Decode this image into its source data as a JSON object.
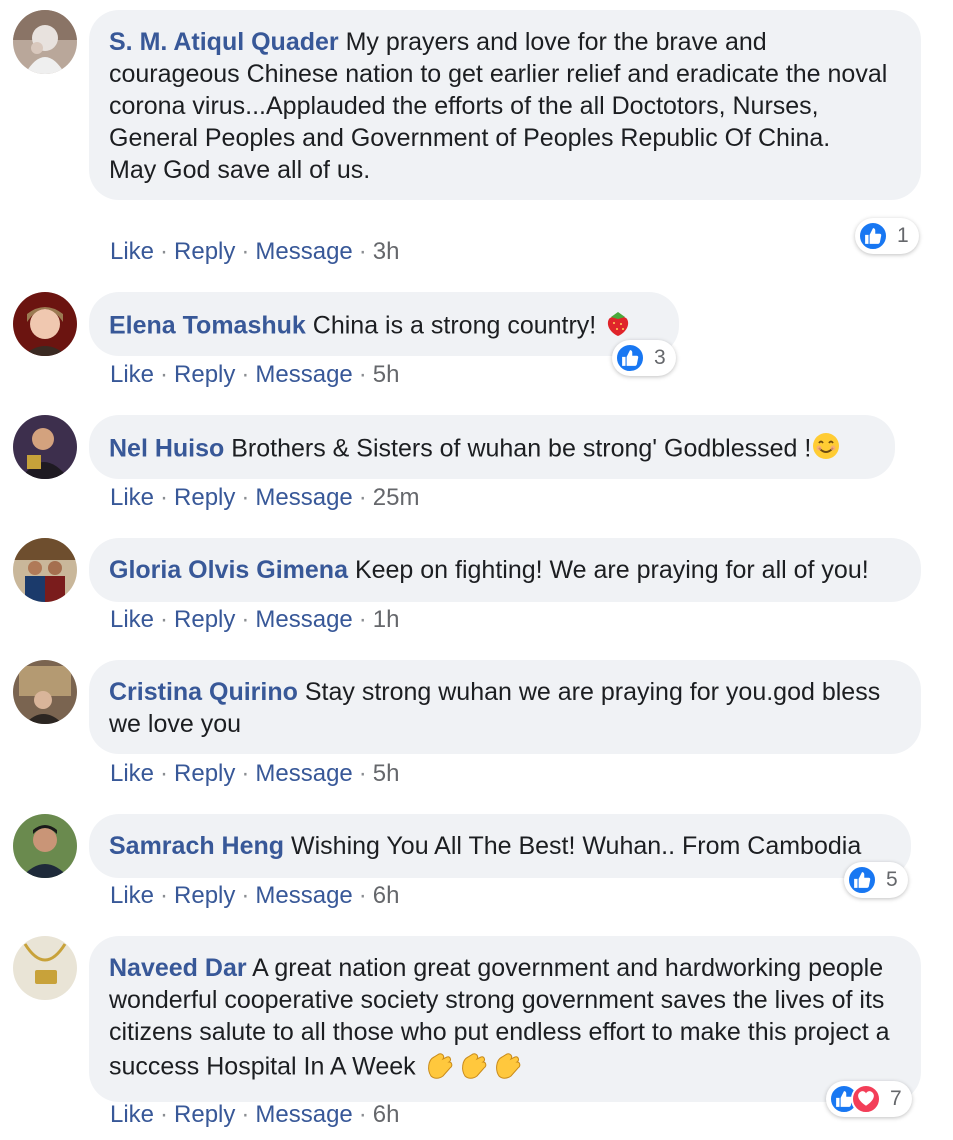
{
  "colors": {
    "author": "#385898",
    "bubble": "#f0f2f5",
    "like_blue": "#1877f2",
    "love_red": "#f33e58",
    "timestamp": "#65676b"
  },
  "action_labels": {
    "like": "Like",
    "reply": "Reply",
    "message": "Message"
  },
  "comments": [
    {
      "author": "S. M. Atiqul Quader",
      "text": "My prayers and love for the brave and courageous Chinese nation to get earlier relief and eradicate the noval corona virus...Applauded the efforts of the all Doctotors, Nurses, General Peoples and Government of Peoples Republic Of China.\nMay God save all of us.",
      "time": "3h",
      "reaction_count": "1",
      "reaction_icons": [
        "like-icon"
      ]
    },
    {
      "author": "Elena Tomashuk",
      "text": "China is a strong country!",
      "emoji": "strawberry-emoji",
      "time": "5h",
      "reaction_count": "3",
      "reaction_icons": [
        "like-icon"
      ]
    },
    {
      "author": "Nel Huiso",
      "text": "Brothers & Sisters of wuhan be strong' Godblessed !",
      "emoji": "smiling-face-emoji",
      "time": "25m"
    },
    {
      "author": "Gloria Olvis Gimena",
      "text": "Keep on fighting! We are praying for all of you!",
      "time": "1h"
    },
    {
      "author": "Cristina Quirino",
      "text": "Stay strong wuhan we are praying for you.god bless we love you",
      "time": "5h"
    },
    {
      "author": "Samrach Heng",
      "text": "Wishing You All The Best! Wuhan.. From Cambodia",
      "time": "6h",
      "reaction_count": "5",
      "reaction_icons": [
        "like-icon"
      ]
    },
    {
      "author": "Naveed Dar",
      "text": "A great nation great government and hardworking people wonderful cooperative society strong government saves the lives of its citizens salute to all those who put endless effort to make this project a success Hospital In A Week",
      "emoji": "clapping-hands-emoji",
      "time": "6h",
      "reaction_count": "7",
      "reaction_icons": [
        "like-icon",
        "love-icon"
      ]
    }
  ]
}
